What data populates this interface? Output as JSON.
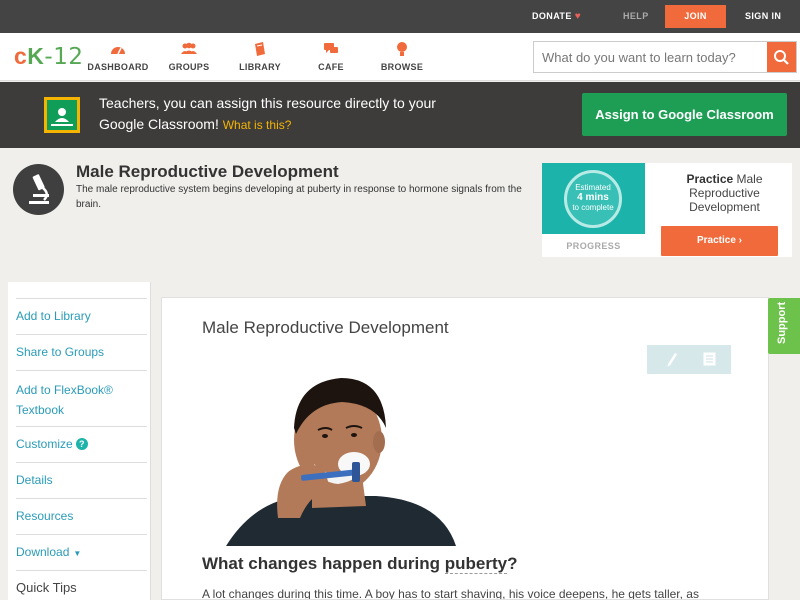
{
  "topbar": {
    "donate": "DONATE",
    "help": "HELP",
    "join": "JOIN",
    "signin": "SIGN IN"
  },
  "nav": {
    "logo_c": "c",
    "logo_k": "K",
    "logo_dash12": "-12",
    "items": [
      {
        "label": "DASHBOARD",
        "icon": "dashboard-icon"
      },
      {
        "label": "GROUPS",
        "icon": "groups-icon"
      },
      {
        "label": "LIBRARY",
        "icon": "library-icon"
      },
      {
        "label": "CAFE",
        "icon": "cafe-icon"
      },
      {
        "label": "BROWSE",
        "icon": "browse-icon"
      }
    ],
    "search_placeholder": "What do you want to learn today?"
  },
  "classroom": {
    "message": "Teachers, you can assign this resource directly to your Google Classroom!",
    "what_link": "What is this?",
    "assign_button": "Assign to Google Classroom"
  },
  "header": {
    "title": "Male Reproductive Development",
    "description": "The male reproductive system begins developing at puberty in response to hormone signals from the brain."
  },
  "practice_card": {
    "estimated": "Estimated",
    "minutes": "4 mins",
    "to_complete": "to complete",
    "progress_label": "PROGRESS",
    "title_bold": "Practice",
    "title_rest": "Male Reproductive Development",
    "button": "Practice"
  },
  "sidebar": {
    "items": [
      "Add to Library",
      "Share to Groups",
      "Add to FlexBook® Textbook",
      "Customize",
      "Details",
      "Resources",
      "Download"
    ],
    "customize_badge": "?",
    "quick_tips": "Quick Tips"
  },
  "content": {
    "title": "Male Reproductive Development",
    "heading_pre": "What changes happen during ",
    "heading_term": "puberty",
    "heading_post": "?",
    "paragraph": "A lot changes during this time. A boy has to start shaving, his voice deepens, he gets taller, as"
  },
  "support_tab": "Support",
  "colors": {
    "accent_orange": "#f06a3c",
    "classroom_green": "#1e9e55",
    "link_blue": "#2a9bb7",
    "support_green": "#6cc24a",
    "teal": "#1bb3aa"
  }
}
